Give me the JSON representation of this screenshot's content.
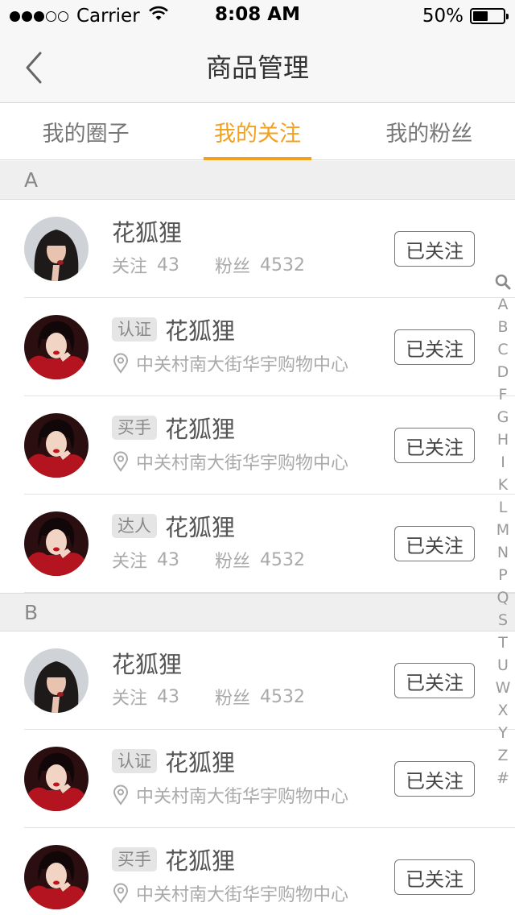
{
  "status_bar": {
    "carrier": "Carrier",
    "time": "8:08 AM",
    "battery_percent": "50%",
    "battery_level": 0.5,
    "signal_dots_filled": 3,
    "signal_dots_total": 5
  },
  "nav": {
    "back_icon": "chevron-left-icon",
    "title": "商品管理"
  },
  "tabs": [
    {
      "label": "我的圈子",
      "active": false
    },
    {
      "label": "我的关注",
      "active": true
    },
    {
      "label": "我的粉丝",
      "active": false
    }
  ],
  "colors": {
    "accent": "#f2a01e",
    "background": "#ffffff",
    "section_bg": "#efefef"
  },
  "sections": [
    {
      "letter": "A",
      "rows": [
        {
          "avatar": "avatar-1",
          "badge": "",
          "name": "花狐狸",
          "type": "stats",
          "follow_label": "关注",
          "follow_count": "43",
          "fans_label": "粉丝",
          "fans_count": "4532",
          "location": "",
          "button": "已关注"
        },
        {
          "avatar": "avatar-2",
          "badge": "认证",
          "name": "花狐狸",
          "type": "location",
          "location": "中关村南大街华宇购物中心",
          "button": "已关注"
        },
        {
          "avatar": "avatar-2",
          "badge": "买手",
          "name": "花狐狸",
          "type": "location",
          "location": "中关村南大街华宇购物中心",
          "button": "已关注"
        },
        {
          "avatar": "avatar-2",
          "badge": "达人",
          "name": "花狐狸",
          "type": "stats",
          "follow_label": "关注",
          "follow_count": "43",
          "fans_label": "粉丝",
          "fans_count": "4532",
          "location": "",
          "button": "已关注"
        }
      ]
    },
    {
      "letter": "B",
      "rows": [
        {
          "avatar": "avatar-1",
          "badge": "",
          "name": "花狐狸",
          "type": "stats",
          "follow_label": "关注",
          "follow_count": "43",
          "fans_label": "粉丝",
          "fans_count": "4532",
          "location": "",
          "button": "已关注"
        },
        {
          "avatar": "avatar-2",
          "badge": "认证",
          "name": "花狐狸",
          "type": "location",
          "location": "中关村南大街华宇购物中心",
          "button": "已关注"
        },
        {
          "avatar": "avatar-2",
          "badge": "买手",
          "name": "花狐狸",
          "type": "location",
          "location": "中关村南大街华宇购物中心",
          "button": "已关注"
        }
      ]
    }
  ],
  "index_bar": {
    "search_icon": "search-icon",
    "letters": [
      "A",
      "B",
      "C",
      "D",
      "F",
      "G",
      "H",
      "I",
      "K",
      "L",
      "M",
      "N",
      "P",
      "Q",
      "S",
      "T",
      "U",
      "W",
      "X",
      "Y",
      "Z",
      "#"
    ]
  }
}
